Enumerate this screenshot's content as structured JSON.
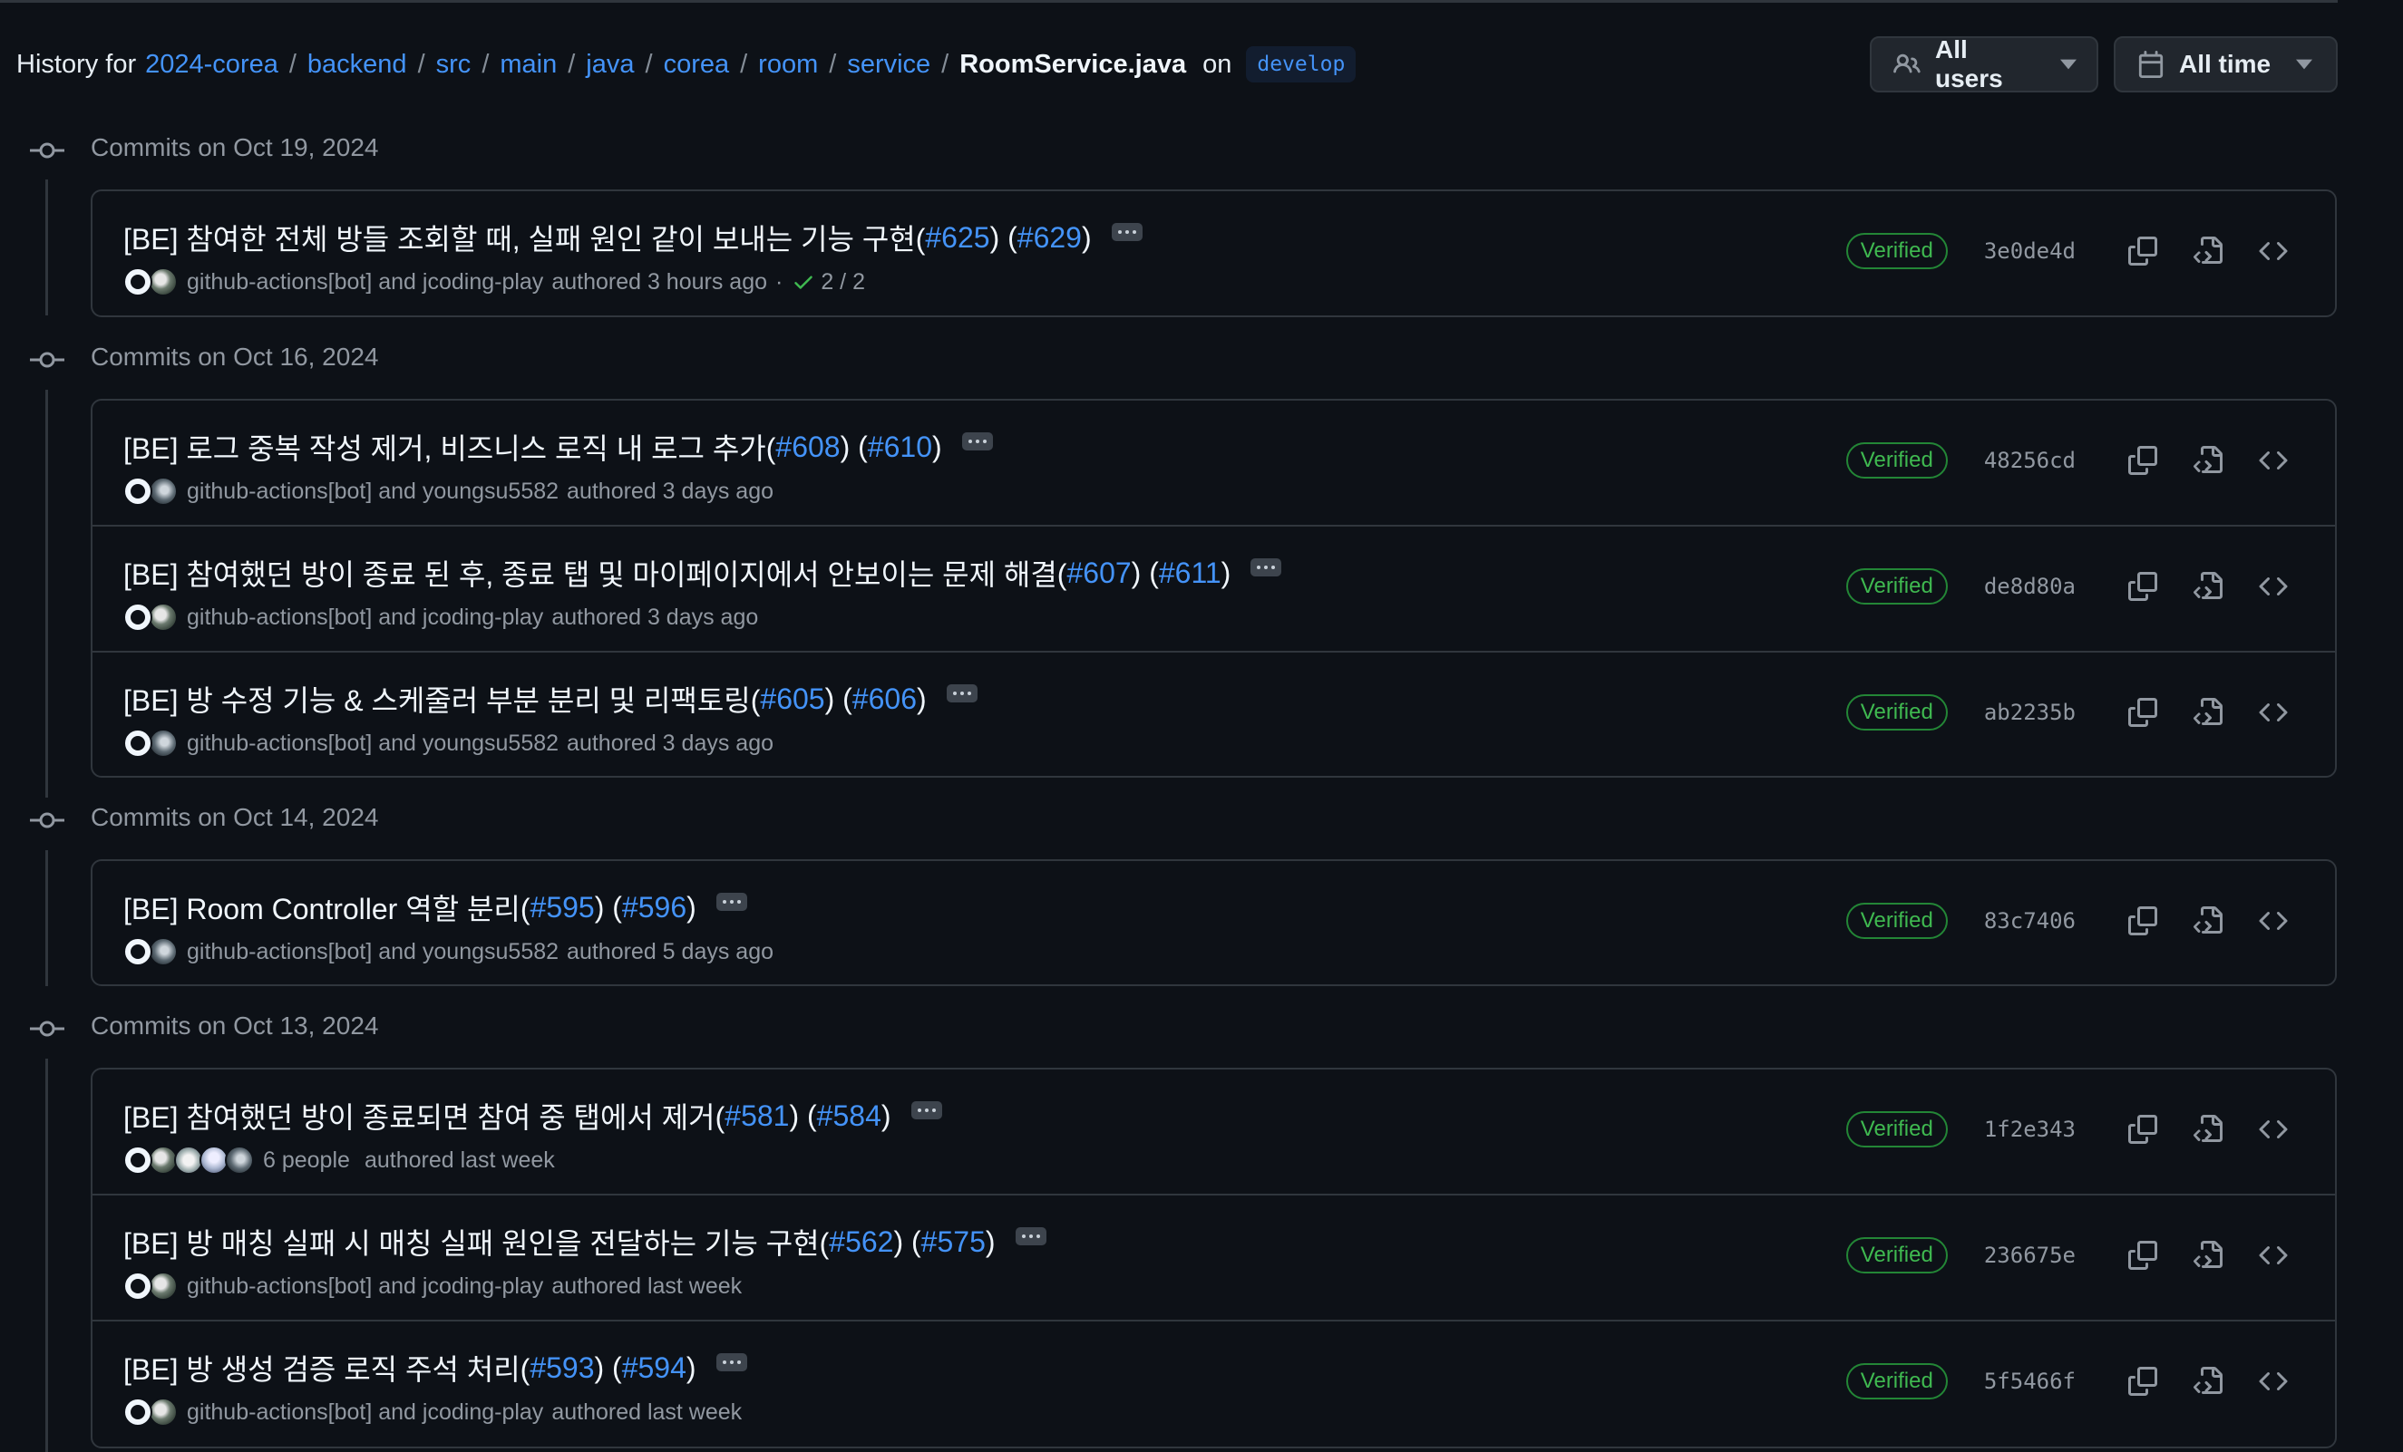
{
  "header": {
    "history_for": "History for",
    "breadcrumbs": [
      "2024-corea",
      "backend",
      "src",
      "main",
      "java",
      "corea",
      "room",
      "service"
    ],
    "separator": "/",
    "file": "RoomService.java",
    "on": "on",
    "branch": "develop"
  },
  "filters": {
    "users": "All users",
    "time": "All time"
  },
  "groups": [
    {
      "title": "Commits on Oct 19, 2024",
      "commits": [
        {
          "title": "[BE] 참여한 전체 방들 조회할 때, 실패 원인 같이 보내는 기능 구현(",
          "pr1": "#625",
          "mid": ") (",
          "pr2": "#629",
          "end": ")",
          "authors": "github-actions[bot] and jcoding-play",
          "authored": "authored 3 hours ago",
          "extra_dot": "·",
          "checks": "2 / 2",
          "verified": "Verified",
          "sha": "3e0de4d"
        }
      ]
    },
    {
      "title": "Commits on Oct 16, 2024",
      "commits": [
        {
          "title": "[BE] 로그 중복 작성 제거, 비즈니스 로직 내 로그 추가(",
          "pr1": "#608",
          "mid": ") (",
          "pr2": "#610",
          "end": ")",
          "authors": "github-actions[bot] and youngsu5582",
          "authored": "authored 3 days ago",
          "verified": "Verified",
          "sha": "48256cd"
        },
        {
          "title": "[BE] 참여했던 방이 종료 된 후, 종료 탭 및 마이페이지에서 안보이는 문제 해결(",
          "pr1": "#607",
          "mid": ") (",
          "pr2": "#611",
          "end": ")",
          "authors": "github-actions[bot] and jcoding-play",
          "authored": "authored 3 days ago",
          "verified": "Verified",
          "sha": "de8d80a"
        },
        {
          "title": "[BE] 방 수정 기능 & 스케줄러 부분 분리 및 리팩토링(",
          "pr1": "#605",
          "mid": ") (",
          "pr2": "#606",
          "end": ")",
          "authors": "github-actions[bot] and youngsu5582",
          "authored": "authored 3 days ago",
          "verified": "Verified",
          "sha": "ab2235b"
        }
      ]
    },
    {
      "title": "Commits on Oct 14, 2024",
      "commits": [
        {
          "title": "[BE] Room Controller 역할 분리(",
          "pr1": "#595",
          "mid": ") (",
          "pr2": "#596",
          "end": ")",
          "authors": "github-actions[bot] and youngsu5582",
          "authored": "authored 5 days ago",
          "verified": "Verified",
          "sha": "83c7406"
        }
      ]
    },
    {
      "title": "Commits on Oct 13, 2024",
      "commits": [
        {
          "title": "[BE] 참여했던 방이 종료되면 참여 중 탭에서 제거(",
          "pr1": "#581",
          "mid": ") (",
          "pr2": "#584",
          "end": ")",
          "authors": "6 people",
          "authored": "authored last week",
          "verified": "Verified",
          "sha": "1f2e343"
        },
        {
          "title": "[BE] 방 매칭 실패 시 매칭 실패 원인을 전달하는 기능 구현(",
          "pr1": "#562",
          "mid": ") (",
          "pr2": "#575",
          "end": ")",
          "authors": "github-actions[bot] and jcoding-play",
          "authored": "authored last week",
          "verified": "Verified",
          "sha": "236675e"
        },
        {
          "title": "[BE] 방 생성 검증 로직 주석 처리(",
          "pr1": "#593",
          "mid": ") (",
          "pr2": "#594",
          "end": ")",
          "authors": "github-actions[bot] and jcoding-play",
          "authored": "authored last week",
          "verified": "Verified",
          "sha": "5f5466f"
        }
      ]
    }
  ],
  "icons": {
    "copy": "copy-icon",
    "browse_files": "file-code-icon",
    "browse_code": "code-icon",
    "commit": "git-commit-icon",
    "people": "people-icon",
    "calendar": "calendar-icon",
    "check": "check-icon"
  },
  "colors": {
    "link": "#4493f8",
    "verified": "#3fb950",
    "background": "#0d1117",
    "border": "#30363d"
  }
}
